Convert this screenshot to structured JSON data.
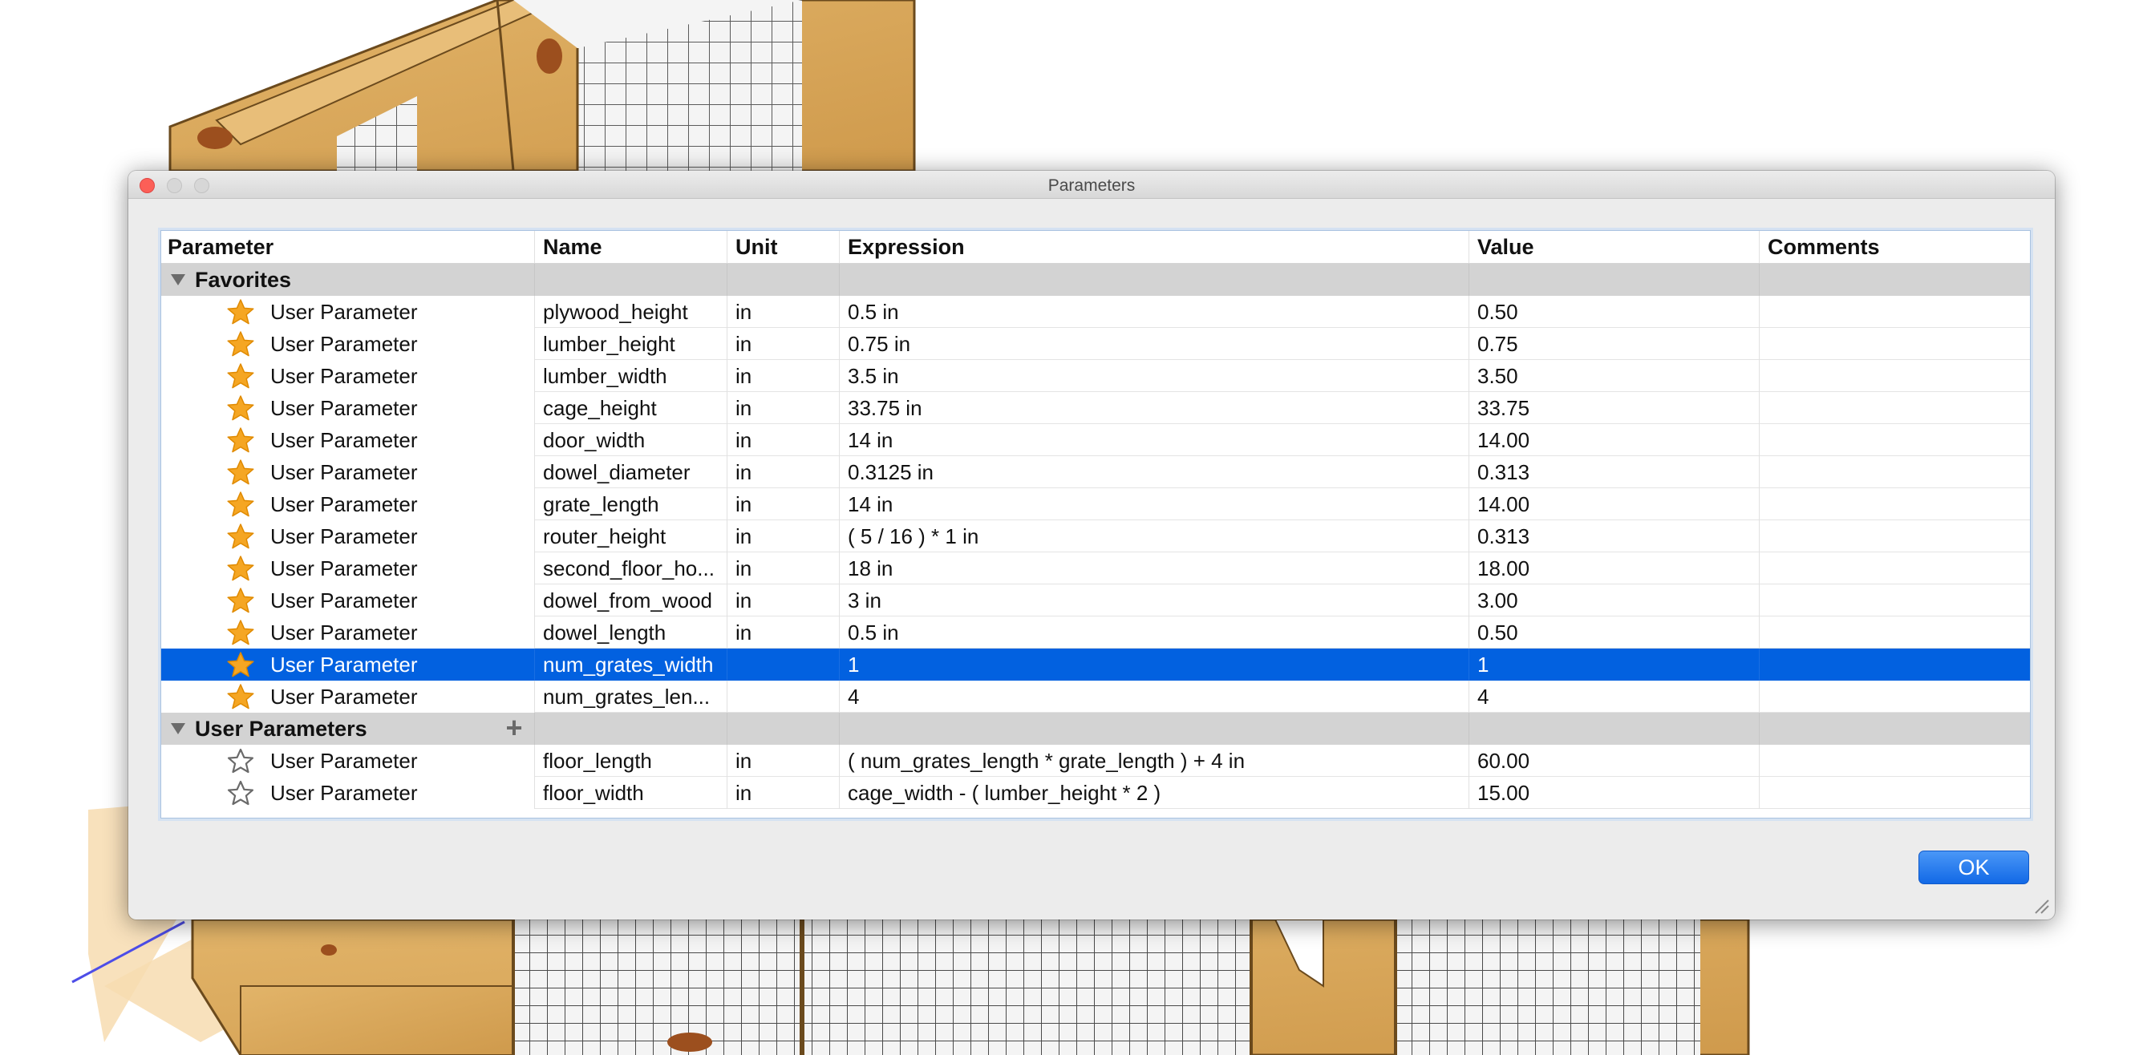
{
  "window": {
    "title": "Parameters"
  },
  "table": {
    "columns": [
      "Parameter",
      "Name",
      "Unit",
      "Expression",
      "Value",
      "Comments"
    ],
    "groups": [
      {
        "label": "Favorites",
        "expanded": true,
        "rows": [
          {
            "type": "User Parameter",
            "name": "plywood_height",
            "unit": "in",
            "expression": "0.5 in",
            "value": "0.50",
            "comments": "",
            "favorite": true
          },
          {
            "type": "User Parameter",
            "name": "lumber_height",
            "unit": "in",
            "expression": "0.75 in",
            "value": "0.75",
            "comments": "",
            "favorite": true
          },
          {
            "type": "User Parameter",
            "name": "lumber_width",
            "unit": "in",
            "expression": "3.5 in",
            "value": "3.50",
            "comments": "",
            "favorite": true
          },
          {
            "type": "User Parameter",
            "name": "cage_height",
            "unit": "in",
            "expression": "33.75 in",
            "value": "33.75",
            "comments": "",
            "favorite": true
          },
          {
            "type": "User Parameter",
            "name": "door_width",
            "unit": "in",
            "expression": "14 in",
            "value": "14.00",
            "comments": "",
            "favorite": true
          },
          {
            "type": "User Parameter",
            "name": "dowel_diameter",
            "unit": "in",
            "expression": "0.3125 in",
            "value": "0.313",
            "comments": "",
            "favorite": true
          },
          {
            "type": "User Parameter",
            "name": "grate_length",
            "unit": "in",
            "expression": "14 in",
            "value": "14.00",
            "comments": "",
            "favorite": true
          },
          {
            "type": "User Parameter",
            "name": "router_height",
            "unit": "in",
            "expression": "( 5 / 16 ) * 1 in",
            "value": "0.313",
            "comments": "",
            "favorite": true
          },
          {
            "type": "User Parameter",
            "name": "second_floor_ho...",
            "unit": "in",
            "expression": "18 in",
            "value": "18.00",
            "comments": "",
            "favorite": true
          },
          {
            "type": "User Parameter",
            "name": "dowel_from_wood",
            "unit": "in",
            "expression": "3 in",
            "value": "3.00",
            "comments": "",
            "favorite": true
          },
          {
            "type": "User Parameter",
            "name": "dowel_length",
            "unit": "in",
            "expression": "0.5 in",
            "value": "0.50",
            "comments": "",
            "favorite": true
          },
          {
            "type": "User Parameter",
            "name": "num_grates_width",
            "unit": "",
            "expression": "1",
            "value": "1",
            "comments": "",
            "favorite": true,
            "selected": true
          },
          {
            "type": "User Parameter",
            "name": "num_grates_len...",
            "unit": "",
            "expression": "4",
            "value": "4",
            "comments": "",
            "favorite": true
          }
        ]
      },
      {
        "label": "User Parameters",
        "expanded": true,
        "add_icon": "plus-icon",
        "rows": [
          {
            "type": "User Parameter",
            "name": "floor_length",
            "unit": "in",
            "expression": "( num_grates_length * grate_length ) + 4 in",
            "value": "60.00",
            "comments": "",
            "favorite": false
          },
          {
            "type": "User Parameter",
            "name": "floor_width",
            "unit": "in",
            "expression": "cage_width - ( lumber_height * 2 )",
            "value": "15.00",
            "comments": "",
            "favorite": false
          }
        ]
      }
    ]
  },
  "buttons": {
    "ok": "OK"
  },
  "colors": {
    "selection": "#0261e0",
    "star_favorite": "#f5a623",
    "star_outline": "#6a6a6a",
    "ok_button": "#1269e6",
    "wood": "#d9a85c"
  },
  "icons": {
    "favorite": "star-filled-icon",
    "not_favorite": "star-outline-icon",
    "expand": "disclosure-triangle-icon",
    "add": "plus-icon",
    "resize": "resize-grip-icon"
  }
}
